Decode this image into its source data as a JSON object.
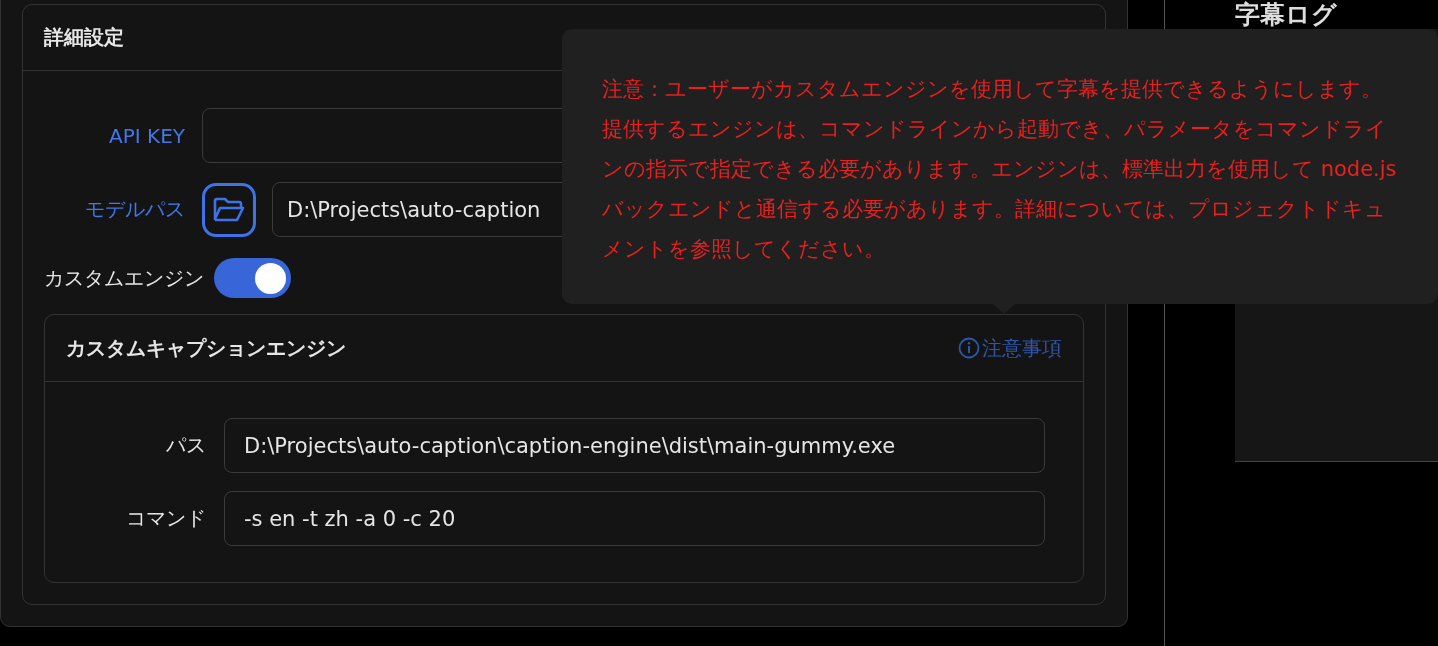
{
  "settings_card": {
    "title": "詳細設定",
    "rows": [
      {
        "kind": "field",
        "label": "API KEY",
        "highlighted": true
      },
      {
        "kind": "folder_field",
        "label": "モデルパス",
        "highlighted": true,
        "value": "D:\\Projects\\auto-caption"
      },
      {
        "kind": "toggle",
        "label": "カスタムエンジン",
        "highlighted": false,
        "on": true
      }
    ],
    "engine_card": {
      "title": "カスタムキャプションエンジン",
      "info_link": "注意事項",
      "fields": [
        {
          "label": "パス",
          "value": "D:\\Projects\\auto-caption\\caption-engine\\dist\\main-gummy.exe"
        },
        {
          "label": "コマンド",
          "value": "-s en -t zh -a 0 -c 20"
        }
      ]
    }
  },
  "caption_log": {
    "title": "字幕ログ"
  },
  "tooltip": {
    "text": "注意：ユーザーがカスタムエンジンを使用して字幕を提供できるようにします。提供するエンジンは、コマンドラインから起動でき、パラメータをコマンドラインの指示で指定できる必要があります。エンジンは、標準出力を使用して node.js バックエンドと通信する必要があります。詳細については、プロジェクトドキュメントを参照してください。"
  }
}
